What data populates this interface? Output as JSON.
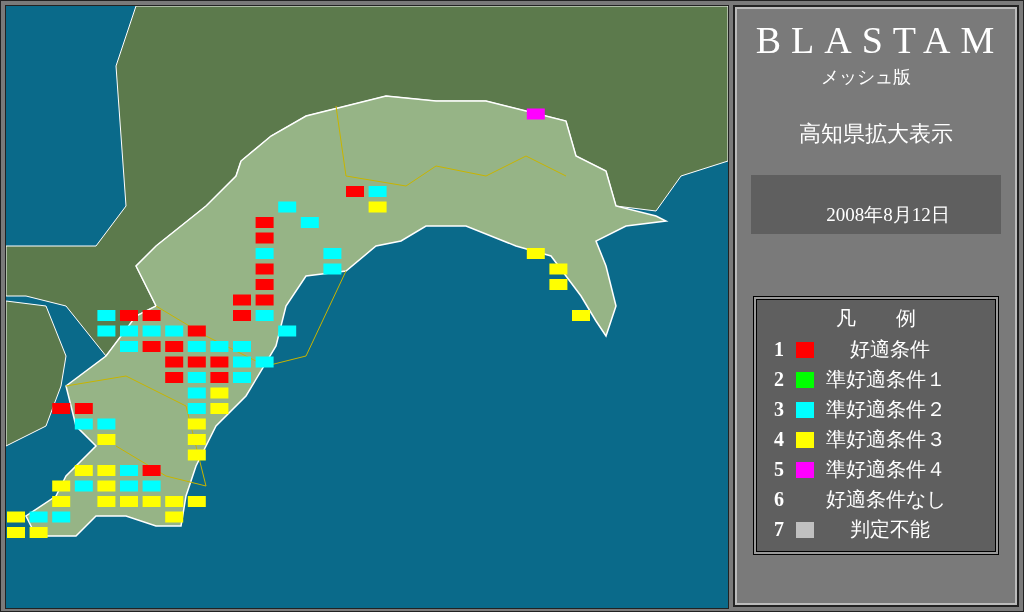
{
  "title": "BLASTAM",
  "subtitle": "メッシュ版",
  "region": "高知県拡大表示",
  "date": "2008年8月12日",
  "legend": {
    "heading": "凡　　例",
    "items": [
      {
        "number": "1",
        "label": "好適条件",
        "color": "#ff0000"
      },
      {
        "number": "2",
        "label": "準好適条件１",
        "color": "#00ff00"
      },
      {
        "number": "3",
        "label": "準好適条件２",
        "color": "#00ffff"
      },
      {
        "number": "4",
        "label": "準好適条件３",
        "color": "#ffff00"
      },
      {
        "number": "5",
        "label": "準好適条件４",
        "color": "#ff00ff"
      },
      {
        "number": "6",
        "label": "好適条件なし"
      },
      {
        "number": "7",
        "label": "判定不能",
        "color": "#c0c0c0"
      }
    ]
  }
}
